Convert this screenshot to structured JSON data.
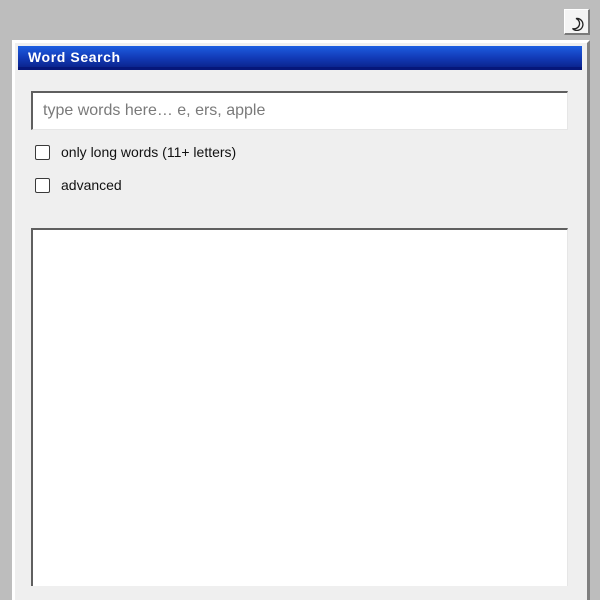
{
  "window": {
    "title": "Word Search"
  },
  "search": {
    "placeholder": "type words here… e, ers, apple",
    "value": ""
  },
  "options": [
    {
      "label": "only long words (11+ letters)",
      "checked": false
    },
    {
      "label": "advanced",
      "checked": false
    }
  ],
  "results": {
    "items": []
  },
  "icons": {
    "theme_toggle": "moon-icon"
  },
  "colors": {
    "titlebar": "#123bb8",
    "background": "#bdbdbd",
    "panel": "#efefef"
  }
}
